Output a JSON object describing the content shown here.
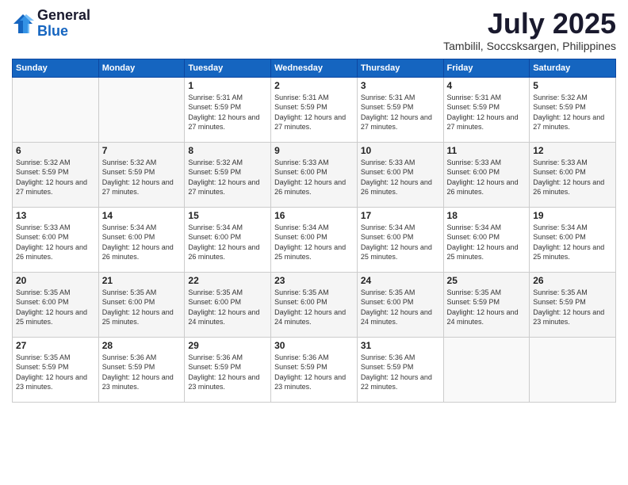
{
  "logo": {
    "general": "General",
    "blue": "Blue"
  },
  "title": "July 2025",
  "location": "Tambilil, Soccsksargen, Philippines",
  "weekdays": [
    "Sunday",
    "Monday",
    "Tuesday",
    "Wednesday",
    "Thursday",
    "Friday",
    "Saturday"
  ],
  "weeks": [
    [
      {
        "day": "",
        "sunrise": "",
        "sunset": "",
        "daylight": ""
      },
      {
        "day": "",
        "sunrise": "",
        "sunset": "",
        "daylight": ""
      },
      {
        "day": "1",
        "sunrise": "Sunrise: 5:31 AM",
        "sunset": "Sunset: 5:59 PM",
        "daylight": "Daylight: 12 hours and 27 minutes."
      },
      {
        "day": "2",
        "sunrise": "Sunrise: 5:31 AM",
        "sunset": "Sunset: 5:59 PM",
        "daylight": "Daylight: 12 hours and 27 minutes."
      },
      {
        "day": "3",
        "sunrise": "Sunrise: 5:31 AM",
        "sunset": "Sunset: 5:59 PM",
        "daylight": "Daylight: 12 hours and 27 minutes."
      },
      {
        "day": "4",
        "sunrise": "Sunrise: 5:31 AM",
        "sunset": "Sunset: 5:59 PM",
        "daylight": "Daylight: 12 hours and 27 minutes."
      },
      {
        "day": "5",
        "sunrise": "Sunrise: 5:32 AM",
        "sunset": "Sunset: 5:59 PM",
        "daylight": "Daylight: 12 hours and 27 minutes."
      }
    ],
    [
      {
        "day": "6",
        "sunrise": "Sunrise: 5:32 AM",
        "sunset": "Sunset: 5:59 PM",
        "daylight": "Daylight: 12 hours and 27 minutes."
      },
      {
        "day": "7",
        "sunrise": "Sunrise: 5:32 AM",
        "sunset": "Sunset: 5:59 PM",
        "daylight": "Daylight: 12 hours and 27 minutes."
      },
      {
        "day": "8",
        "sunrise": "Sunrise: 5:32 AM",
        "sunset": "Sunset: 5:59 PM",
        "daylight": "Daylight: 12 hours and 27 minutes."
      },
      {
        "day": "9",
        "sunrise": "Sunrise: 5:33 AM",
        "sunset": "Sunset: 6:00 PM",
        "daylight": "Daylight: 12 hours and 26 minutes."
      },
      {
        "day": "10",
        "sunrise": "Sunrise: 5:33 AM",
        "sunset": "Sunset: 6:00 PM",
        "daylight": "Daylight: 12 hours and 26 minutes."
      },
      {
        "day": "11",
        "sunrise": "Sunrise: 5:33 AM",
        "sunset": "Sunset: 6:00 PM",
        "daylight": "Daylight: 12 hours and 26 minutes."
      },
      {
        "day": "12",
        "sunrise": "Sunrise: 5:33 AM",
        "sunset": "Sunset: 6:00 PM",
        "daylight": "Daylight: 12 hours and 26 minutes."
      }
    ],
    [
      {
        "day": "13",
        "sunrise": "Sunrise: 5:33 AM",
        "sunset": "Sunset: 6:00 PM",
        "daylight": "Daylight: 12 hours and 26 minutes."
      },
      {
        "day": "14",
        "sunrise": "Sunrise: 5:34 AM",
        "sunset": "Sunset: 6:00 PM",
        "daylight": "Daylight: 12 hours and 26 minutes."
      },
      {
        "day": "15",
        "sunrise": "Sunrise: 5:34 AM",
        "sunset": "Sunset: 6:00 PM",
        "daylight": "Daylight: 12 hours and 26 minutes."
      },
      {
        "day": "16",
        "sunrise": "Sunrise: 5:34 AM",
        "sunset": "Sunset: 6:00 PM",
        "daylight": "Daylight: 12 hours and 25 minutes."
      },
      {
        "day": "17",
        "sunrise": "Sunrise: 5:34 AM",
        "sunset": "Sunset: 6:00 PM",
        "daylight": "Daylight: 12 hours and 25 minutes."
      },
      {
        "day": "18",
        "sunrise": "Sunrise: 5:34 AM",
        "sunset": "Sunset: 6:00 PM",
        "daylight": "Daylight: 12 hours and 25 minutes."
      },
      {
        "day": "19",
        "sunrise": "Sunrise: 5:34 AM",
        "sunset": "Sunset: 6:00 PM",
        "daylight": "Daylight: 12 hours and 25 minutes."
      }
    ],
    [
      {
        "day": "20",
        "sunrise": "Sunrise: 5:35 AM",
        "sunset": "Sunset: 6:00 PM",
        "daylight": "Daylight: 12 hours and 25 minutes."
      },
      {
        "day": "21",
        "sunrise": "Sunrise: 5:35 AM",
        "sunset": "Sunset: 6:00 PM",
        "daylight": "Daylight: 12 hours and 25 minutes."
      },
      {
        "day": "22",
        "sunrise": "Sunrise: 5:35 AM",
        "sunset": "Sunset: 6:00 PM",
        "daylight": "Daylight: 12 hours and 24 minutes."
      },
      {
        "day": "23",
        "sunrise": "Sunrise: 5:35 AM",
        "sunset": "Sunset: 6:00 PM",
        "daylight": "Daylight: 12 hours and 24 minutes."
      },
      {
        "day": "24",
        "sunrise": "Sunrise: 5:35 AM",
        "sunset": "Sunset: 6:00 PM",
        "daylight": "Daylight: 12 hours and 24 minutes."
      },
      {
        "day": "25",
        "sunrise": "Sunrise: 5:35 AM",
        "sunset": "Sunset: 5:59 PM",
        "daylight": "Daylight: 12 hours and 24 minutes."
      },
      {
        "day": "26",
        "sunrise": "Sunrise: 5:35 AM",
        "sunset": "Sunset: 5:59 PM",
        "daylight": "Daylight: 12 hours and 23 minutes."
      }
    ],
    [
      {
        "day": "27",
        "sunrise": "Sunrise: 5:35 AM",
        "sunset": "Sunset: 5:59 PM",
        "daylight": "Daylight: 12 hours and 23 minutes."
      },
      {
        "day": "28",
        "sunrise": "Sunrise: 5:36 AM",
        "sunset": "Sunset: 5:59 PM",
        "daylight": "Daylight: 12 hours and 23 minutes."
      },
      {
        "day": "29",
        "sunrise": "Sunrise: 5:36 AM",
        "sunset": "Sunset: 5:59 PM",
        "daylight": "Daylight: 12 hours and 23 minutes."
      },
      {
        "day": "30",
        "sunrise": "Sunrise: 5:36 AM",
        "sunset": "Sunset: 5:59 PM",
        "daylight": "Daylight: 12 hours and 23 minutes."
      },
      {
        "day": "31",
        "sunrise": "Sunrise: 5:36 AM",
        "sunset": "Sunset: 5:59 PM",
        "daylight": "Daylight: 12 hours and 22 minutes."
      },
      {
        "day": "",
        "sunrise": "",
        "sunset": "",
        "daylight": ""
      },
      {
        "day": "",
        "sunrise": "",
        "sunset": "",
        "daylight": ""
      }
    ]
  ]
}
